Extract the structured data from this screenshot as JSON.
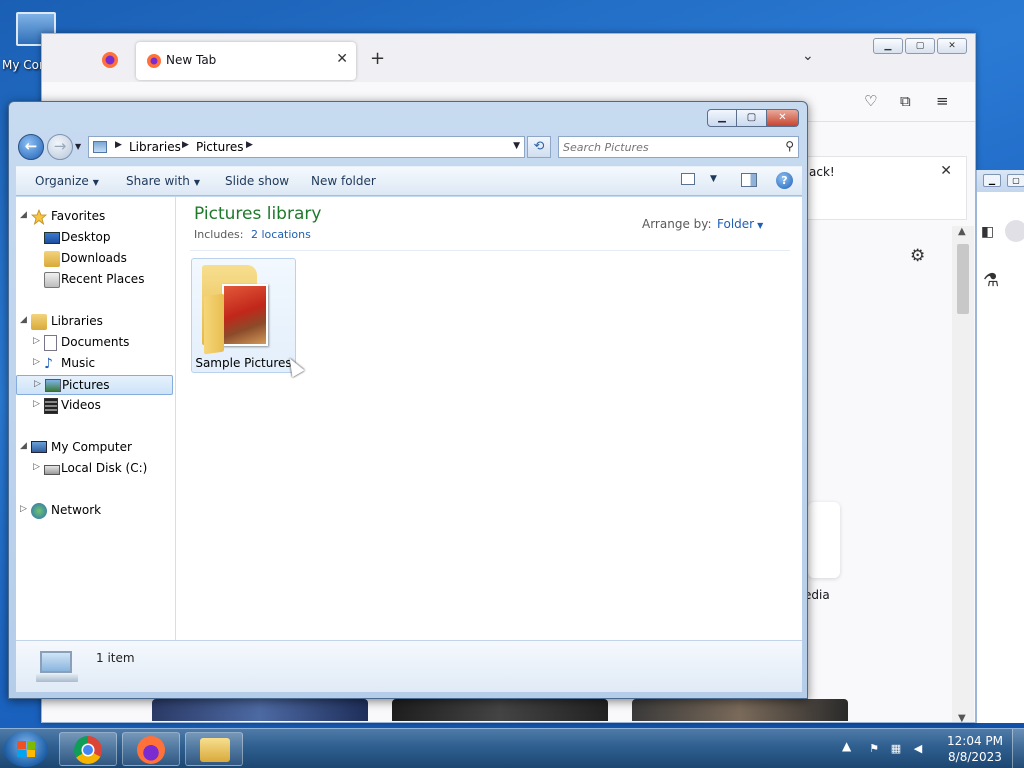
{
  "desktop": {
    "computer_icon_label": "My Computer"
  },
  "firefox": {
    "tab_title": "New Tab",
    "notice_text": "ack!",
    "card_label": "edia",
    "close_glyph": "✕",
    "new_tab_glyph": "+"
  },
  "explorer": {
    "breadcrumb": [
      "Libraries",
      "Pictures"
    ],
    "search_placeholder": "Search Pictures",
    "commands": {
      "organize": "Organize",
      "share_with": "Share with",
      "slide_show": "Slide show",
      "new_folder": "New folder"
    },
    "nav": {
      "favorites": "Favorites",
      "desktop": "Desktop",
      "downloads": "Downloads",
      "recent_places": "Recent Places",
      "libraries": "Libraries",
      "documents": "Documents",
      "music": "Music",
      "pictures": "Pictures",
      "videos": "Videos",
      "my_computer": "My Computer",
      "local_disk": "Local Disk (C:)",
      "network": "Network"
    },
    "content": {
      "title": "Pictures library",
      "includes_label": "Includes:",
      "includes_link": "2 locations",
      "arrange_by_label": "Arrange by:",
      "arrange_by_value": "Folder",
      "items": [
        {
          "name": "Sample Pictures"
        }
      ]
    },
    "details": {
      "count": "1 item"
    }
  },
  "taskbar": {
    "time": "12:04 PM",
    "date": "8/8/2023",
    "apps": [
      "chrome-icon",
      "firefox-icon",
      "file-explorer-icon"
    ]
  },
  "colors": {
    "library_title": "#1e7a2b",
    "link": "#1f5fb4",
    "selection": "#cde3f8"
  }
}
